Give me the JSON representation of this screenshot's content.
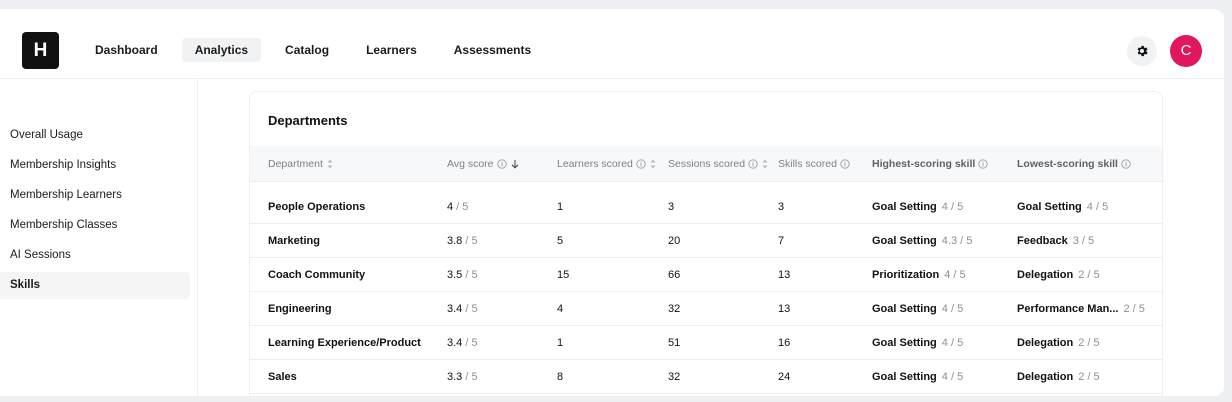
{
  "colors": {
    "accent": "#e0165f",
    "logo_bg": "#111111",
    "muted_text": "#8b9097"
  },
  "header": {
    "logo_letter": "H",
    "nav": [
      {
        "label": "Dashboard",
        "active": false
      },
      {
        "label": "Analytics",
        "active": true
      },
      {
        "label": "Catalog",
        "active": false
      },
      {
        "label": "Learners",
        "active": false
      },
      {
        "label": "Assessments",
        "active": false
      }
    ],
    "settings_icon": "gear-icon",
    "avatar_letter": "C"
  },
  "sidebar": {
    "items": [
      {
        "label": "Overall Usage",
        "active": false
      },
      {
        "label": "Membership Insights",
        "active": false
      },
      {
        "label": "Membership Learners",
        "active": false
      },
      {
        "label": "Membership Classes",
        "active": false
      },
      {
        "label": "AI Sessions",
        "active": false
      },
      {
        "label": "Skills",
        "active": true
      }
    ]
  },
  "departments": {
    "title": "Departments",
    "columns": {
      "department": "Department",
      "avg_score": "Avg score",
      "learners_scored": "Learners scored",
      "sessions_scored": "Sessions scored",
      "skills_scored": "Skills scored",
      "highest_skill": "Highest-scoring skill",
      "lowest_skill": "Lowest-scoring skill"
    },
    "rows": [
      {
        "department": "People Operations",
        "avg": "4",
        "avg_out": " / 5",
        "learners": "1",
        "sessions": "3",
        "skills": "3",
        "high_name": "Goal Setting",
        "high_score": "4 / 5",
        "low_name": "Goal Setting",
        "low_score": "4 / 5"
      },
      {
        "department": "Marketing",
        "avg": "3.8",
        "avg_out": " / 5",
        "learners": "5",
        "sessions": "20",
        "skills": "7",
        "high_name": "Goal Setting",
        "high_score": "4.3 / 5",
        "low_name": "Feedback",
        "low_score": "3 / 5"
      },
      {
        "department": "Coach Community",
        "avg": "3.5",
        "avg_out": " / 5",
        "learners": "15",
        "sessions": "66",
        "skills": "13",
        "high_name": "Prioritization",
        "high_score": "4 / 5",
        "low_name": "Delegation",
        "low_score": "2 / 5"
      },
      {
        "department": "Engineering",
        "avg": "3.4",
        "avg_out": " / 5",
        "learners": "4",
        "sessions": "32",
        "skills": "13",
        "high_name": "Goal Setting",
        "high_score": "4 / 5",
        "low_name": "Performance Man...",
        "low_score": "2 / 5"
      },
      {
        "department": "Learning Experience/Product",
        "avg": "3.4",
        "avg_out": " / 5",
        "learners": "1",
        "sessions": "51",
        "skills": "16",
        "high_name": "Goal Setting",
        "high_score": "4 / 5",
        "low_name": "Delegation",
        "low_score": "2 / 5"
      },
      {
        "department": "Sales",
        "avg": "3.3",
        "avg_out": " / 5",
        "learners": "8",
        "sessions": "32",
        "skills": "24",
        "high_name": "Goal Setting",
        "high_score": "4 / 5",
        "low_name": "Delegation",
        "low_score": "2 / 5"
      }
    ]
  }
}
